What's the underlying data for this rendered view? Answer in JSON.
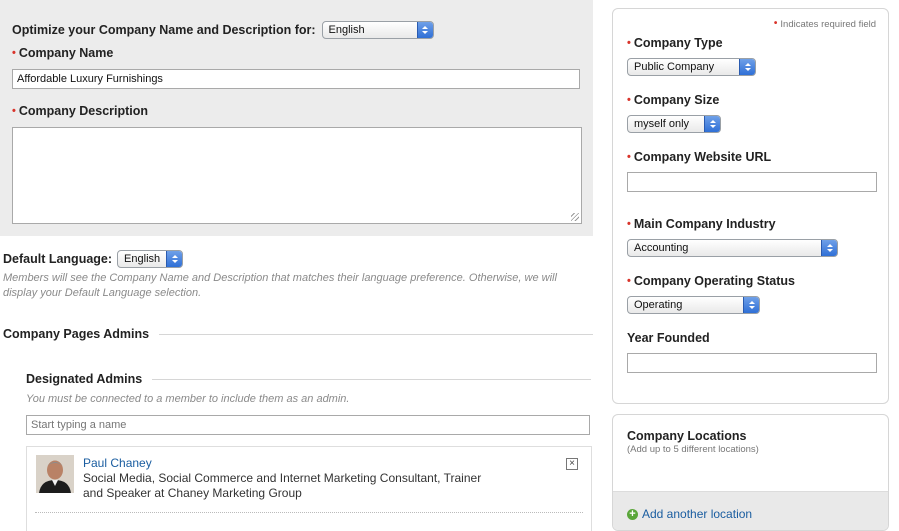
{
  "optimize": {
    "label": "Optimize your Company Name and Description for:",
    "language": "English"
  },
  "company_name": {
    "label": "Company Name",
    "value": "Affordable Luxury Furnishings"
  },
  "company_description": {
    "label": "Company Description",
    "value": ""
  },
  "default_language": {
    "label": "Default Language:",
    "value": "English",
    "help": "Members will see the Company Name and Description that matches their language preference. Otherwise, we will display your Default Language selection."
  },
  "admins": {
    "section_title": "Company Pages Admins",
    "designated_title": "Designated Admins",
    "help": "You must be connected to a member to include them as an admin.",
    "search_placeholder": "Start typing a name",
    "list": [
      {
        "name": "Paul Chaney",
        "title": "Social Media, Social Commerce and Internet Marketing Consultant, Trainer and Speaker at Chaney Marketing Group",
        "remove_glyph": "×"
      }
    ]
  },
  "required_note": "Indicates required field",
  "required_marker": "•",
  "right_fields": {
    "company_type": {
      "label": "Company Type",
      "value": "Public Company"
    },
    "company_size": {
      "label": "Company Size",
      "value": "myself only"
    },
    "website": {
      "label": "Company Website URL",
      "value": ""
    },
    "industry": {
      "label": "Main Company Industry",
      "value": "Accounting"
    },
    "status": {
      "label": "Company Operating Status",
      "value": "Operating"
    },
    "year_founded": {
      "label": "Year Founded",
      "value": ""
    }
  },
  "locations": {
    "title": "Company Locations",
    "subtitle": "(Add up to 5 different locations)",
    "add_label": "Add another location",
    "add_icon": "plus-circle-icon"
  },
  "colors": {
    "required": "#d9342b",
    "link": "#1a5da0",
    "panel_gray": "#ececec",
    "select_arrow": "#2f6fd6",
    "add_icon": "#5aa63a"
  }
}
